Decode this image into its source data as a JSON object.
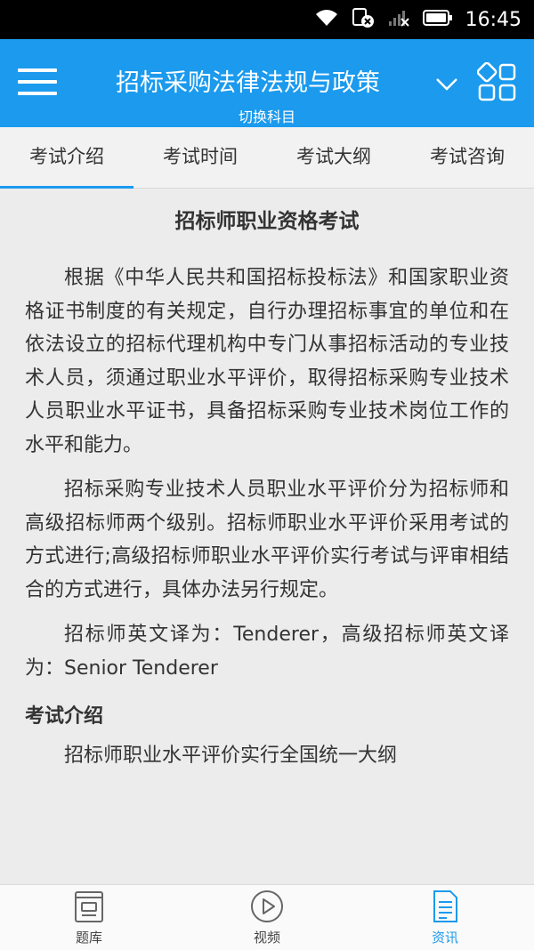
{
  "status_bar": {
    "time": "16:45"
  },
  "header": {
    "title": "招标采购法律法规与政策",
    "subtitle": "切换科目"
  },
  "tabs": [
    {
      "label": "考试介绍",
      "active": true
    },
    {
      "label": "考试时间",
      "active": false
    },
    {
      "label": "考试大纲",
      "active": false
    },
    {
      "label": "考试咨询",
      "active": false
    }
  ],
  "article": {
    "title": "招标师职业资格考试",
    "paragraphs": [
      "根据《中华人民共和国招标投标法》和国家职业资格证书制度的有关规定，自行办理招标事宜的单位和在依法设立的招标代理机构中专门从事招标活动的专业技术人员，须通过职业水平评价，取得招标采购专业技术人员职业水平证书，具备招标采购专业技术岗位工作的水平和能力。",
      "招标采购专业技术人员职业水平评价分为招标师和高级招标师两个级别。招标师职业水平评价采用考试的方式进行;高级招标师职业水平评价实行考试与评审相结合的方式进行，具体办法另行规定。",
      "招标师英文译为：Tenderer，高级招标师英文译为：Senior Tenderer"
    ],
    "section_heading": "考试介绍",
    "section_paragraph": "招标师职业水平评价实行全国统一大纲"
  },
  "bottom_nav": [
    {
      "label": "题库",
      "icon": "question-bank-icon",
      "active": false
    },
    {
      "label": "视频",
      "icon": "play-icon",
      "active": false
    },
    {
      "label": "资讯",
      "icon": "news-document-icon",
      "active": true
    }
  ],
  "colors": {
    "accent": "#1b9aee",
    "background": "#ececec"
  }
}
